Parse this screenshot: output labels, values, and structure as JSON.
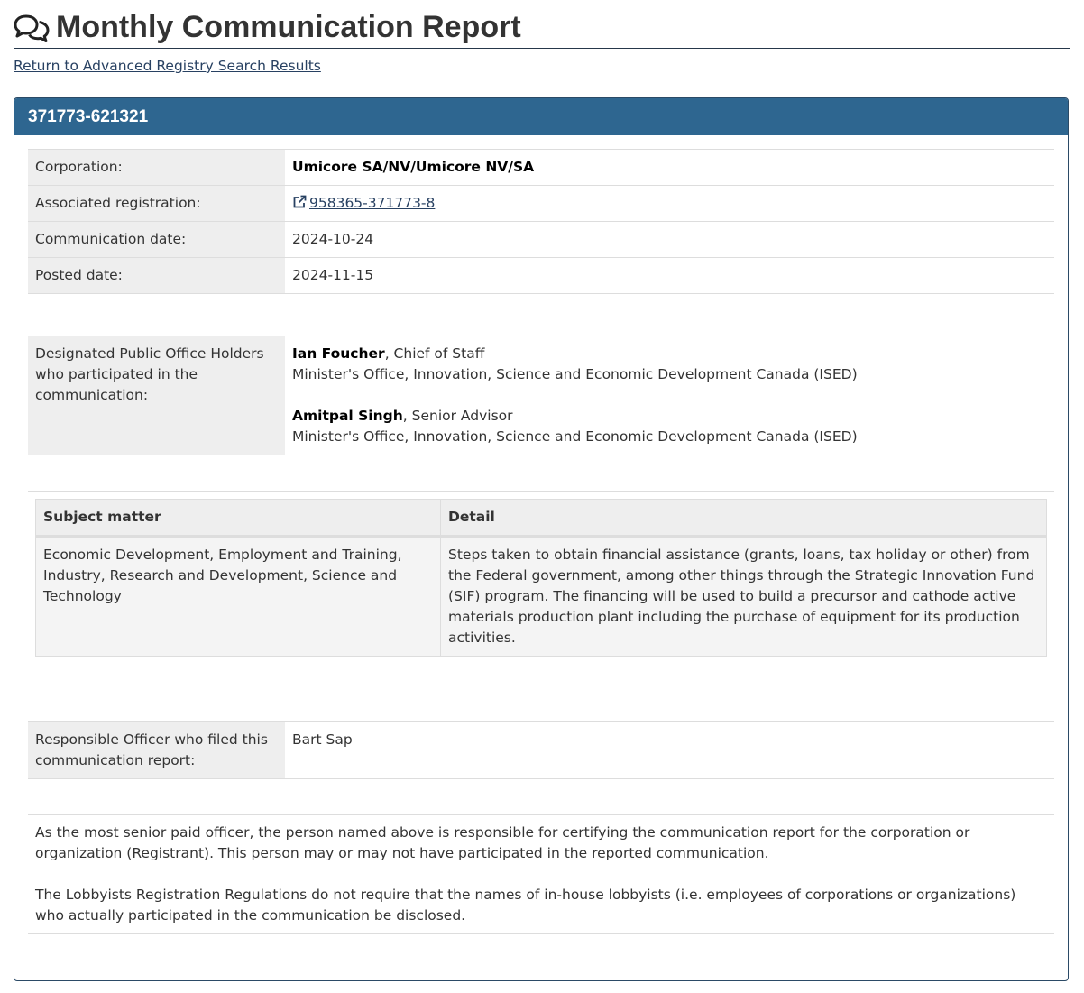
{
  "page_title": "Monthly Communication Report",
  "return_link": "Return to Advanced Registry Search Results",
  "report": {
    "id": "371773-621321",
    "corporation_label": "Corporation:",
    "corporation": "Umicore SA/NV/Umicore NV/SA",
    "associated_registration_label": "Associated registration:",
    "associated_registration": "958365-371773-8",
    "communication_date_label": "Communication date:",
    "communication_date": "2024-10-24",
    "posted_date_label": "Posted date:",
    "posted_date": "2024-11-15"
  },
  "dpoh": {
    "label": "Designated Public Office Holders who participated in the communication:",
    "holders": [
      {
        "name": "Ian Foucher",
        "title": ", Chief of Staff",
        "office": "Minister's Office, Innovation, Science and Economic Development Canada (ISED)"
      },
      {
        "name": "Amitpal Singh",
        "title": ", Senior Advisor",
        "office": "Minister's Office, Innovation, Science and Economic Development Canada (ISED)"
      }
    ]
  },
  "subjects": {
    "headers": [
      "Subject matter",
      "Detail"
    ],
    "rows": [
      {
        "subject": "Economic Development, Employment and Training, Industry, Research and Development, Science and Technology",
        "detail": "Steps taken to obtain financial assistance (grants, loans, tax holiday or other) from the Federal government, among other things through the Strategic Innovation Fund (SIF) program. The financing will be used to build a precursor and cathode active materials production plant including the purchase of equipment for its production activities."
      }
    ]
  },
  "responsible_officer": {
    "label": "Responsible Officer who filed this communication report:",
    "name": "Bart Sap"
  },
  "notes": [
    "As the most senior paid officer, the person named above is responsible for certifying the communication report for the corporation or organization (Registrant). This person may or may not have participated in the reported communication.",
    "The Lobbyists Registration Regulations do not require that the names of in-house lobbyists (i.e. employees of corporations or organizations) who actually participated in the communication be disclosed."
  ],
  "colors": {
    "panel_heading": "#2e6690",
    "link": "#284162",
    "label_bg": "#eeeeee"
  },
  "icons": {
    "title": "comments-icon",
    "registration_link": "external-link-icon"
  }
}
